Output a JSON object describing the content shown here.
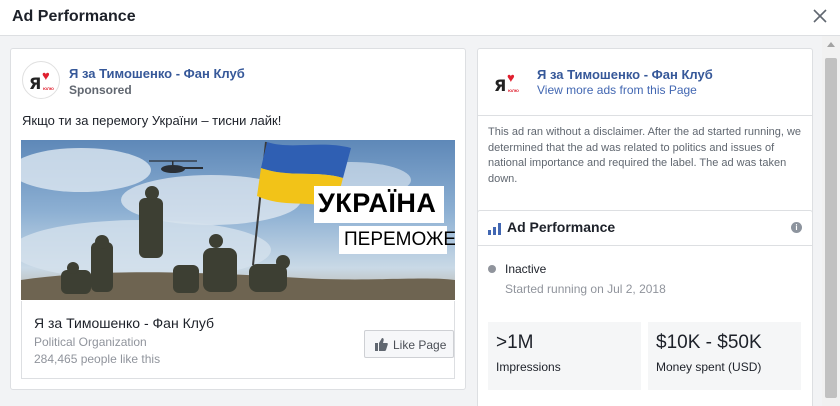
{
  "header": {
    "title": "Ad Performance"
  },
  "ad": {
    "page_name": "Я за Тимошенко - Фан Клуб",
    "sponsored": "Sponsored",
    "text": "Якщо ти за перемогу України – тисни лайк!",
    "image": {
      "line1": "УКРАЇНА",
      "line2": "ПЕРЕМОЖЕ!"
    },
    "link": {
      "name": "Я за Тимошенко - Фан Клуб",
      "category": "Political Organization",
      "likes": "284,465 people like this",
      "button_label": "Like Page"
    }
  },
  "logo": {
    "letter": "Я",
    "sub": "ЮЛЮ"
  },
  "page_card": {
    "page_name": "Я за Тимошенко - Фан Клуб",
    "more_ads": "View more ads from this Page",
    "disclaimer": "This ad ran without a disclaimer. After the ad started running, we determined that the ad was related to politics and issues of national importance and required the label. The ad was taken down."
  },
  "performance": {
    "title": "Ad Performance",
    "status": "Inactive",
    "started": "Started running on Jul 2, 2018",
    "impressions_value": ">1M",
    "impressions_label": "Impressions",
    "spent_value": "$10K - $50K",
    "spent_label": "Money spent (USD)"
  },
  "icons": {
    "close": "close-icon",
    "like": "thumbs-up-icon",
    "performance": "bar-chart-icon",
    "info": "info-icon"
  },
  "colors": {
    "link_blue": "#365899",
    "accent_blue": "#4267b2",
    "logo_red": "#e0202f",
    "flag_blue": "#2f5fb3",
    "flag_yellow": "#f2c318"
  }
}
